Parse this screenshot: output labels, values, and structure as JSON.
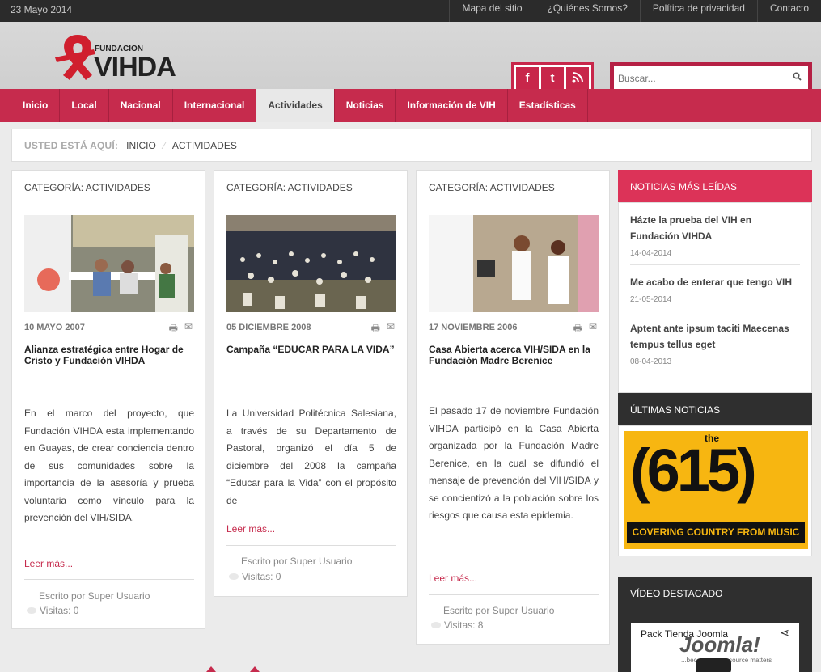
{
  "topbar": {
    "date": "23 Mayo 2014",
    "links": [
      "Mapa del sitio",
      "¿Quiénes Somos?",
      "Política de privacidad",
      "Contacto"
    ]
  },
  "header": {
    "logo_small": "FUNDACION",
    "logo_big": "VIHDA",
    "search_placeholder": "Buscar..."
  },
  "nav": {
    "items": [
      "Inicio",
      "Local",
      "Nacional",
      "Internacional",
      "Actividades",
      "Noticias",
      "Información de VIH",
      "Estadísticas"
    ],
    "active": "Actividades"
  },
  "breadcrumb": {
    "label": "USTED ESTÁ AQUÍ:",
    "items": [
      "INICIO",
      "ACTIVIDADES"
    ]
  },
  "articles": [
    {
      "category": "CATEGORÍA: ACTIVIDADES",
      "date": "10 MAYO 2007",
      "title": "Alianza estratégica entre Hogar de Cristo y Fundación VIHDA",
      "body": "En el marco del proyecto, que Fundación VIHDA esta implementando en Guayas, de crear conciencia dentro de sus comunidades sobre la importancia de la asesoría y prueba voluntaria como vínculo para la prevención del VIH/SIDA,",
      "more": "Leer más...",
      "author": "Escrito por Super Usuario",
      "visits": "Visitas: 0"
    },
    {
      "category": "CATEGORÍA: ACTIVIDADES",
      "date": "05 DICIEMBRE 2008",
      "title": "Campaña “EDUCAR PARA LA VIDA”",
      "body": "La Universidad Politécnica Salesiana, a través de su Departamento de Pastoral, organizó el día 5 de diciembre del 2008 la campaña “Educar para la Vida” con el propósito de",
      "more": "Leer más...",
      "author": "Escrito por Super Usuario",
      "visits": "Visitas: 0"
    },
    {
      "category": "CATEGORÍA: ACTIVIDADES",
      "date": "17 NOVIEMBRE 2006",
      "title": "Casa Abierta acerca VIH/SIDA en la Fundación Madre Berenice",
      "body": "El pasado 17 de noviembre Fundación VIHDA participó en la Casa Abierta organizada por la Fundación Madre Berenice, en la cual se difundió el mensaje de prevención del VIH/SIDA y se concientizó a la población sobre los riesgos que causa esta epidemia.",
      "more": "Leer más...",
      "author": "Escrito por Super Usuario",
      "visits": "Visitas: 8"
    }
  ],
  "sidebar": {
    "popular_title": "NOTICIAS MÁS LEÍDAS",
    "popular": [
      {
        "title": "Házte la prueba del VIH en Fundación VIHDA",
        "date": "14-04-2014"
      },
      {
        "title": "Me acabo de enterar que tengo VIH",
        "date": "21-05-2014"
      },
      {
        "title": "Aptent ante ipsum taciti Maecenas tempus tellus eget",
        "date": "08-04-2013"
      }
    ],
    "latest_title": "ÚLTIMAS NOTICIAS",
    "ad": {
      "the": "the",
      "number": "(615)",
      "tagline": "COVERING COUNTRY FROM MUSIC CITY"
    },
    "video_title": "VÍDEO DESTACADO",
    "video": {
      "title": "Pack Tienda Joomla",
      "brand": "Joomla!",
      "sub": "...because open source matters"
    }
  }
}
